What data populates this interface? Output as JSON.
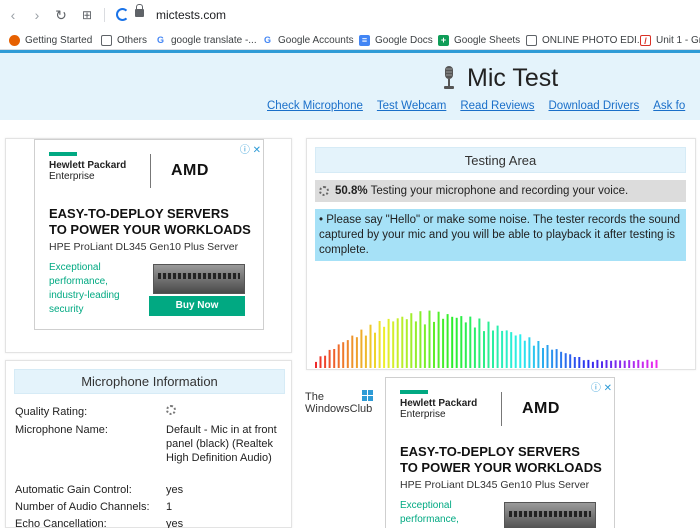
{
  "browser": {
    "url": "mictests.com",
    "bookmarks": [
      {
        "label": "Getting Started",
        "icon": "firefox-icon",
        "color": "#e66000"
      },
      {
        "label": "Others",
        "icon": "folder-icon",
        "color": "#5f6368"
      },
      {
        "label": "google translate -...",
        "icon": "google-icon",
        "color": "#4285f4"
      },
      {
        "label": "Google Accounts",
        "icon": "google-icon",
        "color": "#4285f4"
      },
      {
        "label": "Google Docs",
        "icon": "docs-icon",
        "color": "#4285f4"
      },
      {
        "label": "Google Sheets",
        "icon": "sheets-icon",
        "color": "#0f9d58"
      },
      {
        "label": "ONLINE PHOTO EDI...",
        "icon": "page-icon",
        "color": "#5f6368"
      },
      {
        "label": "Unit 1 - Gr",
        "icon": "unit-icon",
        "color": "#d93025"
      }
    ]
  },
  "site": {
    "title": "Mic Test",
    "nav": [
      "Check Microphone",
      "Test Webcam",
      "Read Reviews",
      "Download Drivers",
      "Ask fo"
    ]
  },
  "ads": {
    "brand_line1": "Hewlett Packard",
    "brand_line2": "Enterprise",
    "partner": "AMD",
    "headline1": "EASY-TO-DEPLOY SERVERS",
    "headline2": "TO POWER YOUR WORKLOADS",
    "product": "HPE ProLiant DL345 Gen10 Plus Server",
    "tagline": [
      "Exceptional",
      "performance,",
      "industry-leading",
      "security"
    ],
    "cta": "Buy Now"
  },
  "testing": {
    "title": "Testing Area",
    "progress_value": "50.8%",
    "progress_fraction": 0.508,
    "progress_text": " Testing your microphone and recording your voice.",
    "instruction": "• Please say \"Hello\" or make some noise. The tester records the sound captured by your mic and you will be able to playback it after testing is complete."
  },
  "mic_info": {
    "title": "Microphone Information",
    "rows": [
      {
        "label": "Quality Rating:",
        "value": ""
      },
      {
        "label": "Microphone Name:",
        "value": "Default - Mic in at front panel (black) (Realtek High Definition Audio)"
      },
      {
        "label": "Automatic Gain Control:",
        "value": "yes"
      },
      {
        "label": "Number of Audio Channels:",
        "value": "1"
      },
      {
        "label": "Echo Cancellation:",
        "value": "yes"
      }
    ]
  },
  "watermark": {
    "line1": "The",
    "line2": "WindowsClub"
  }
}
